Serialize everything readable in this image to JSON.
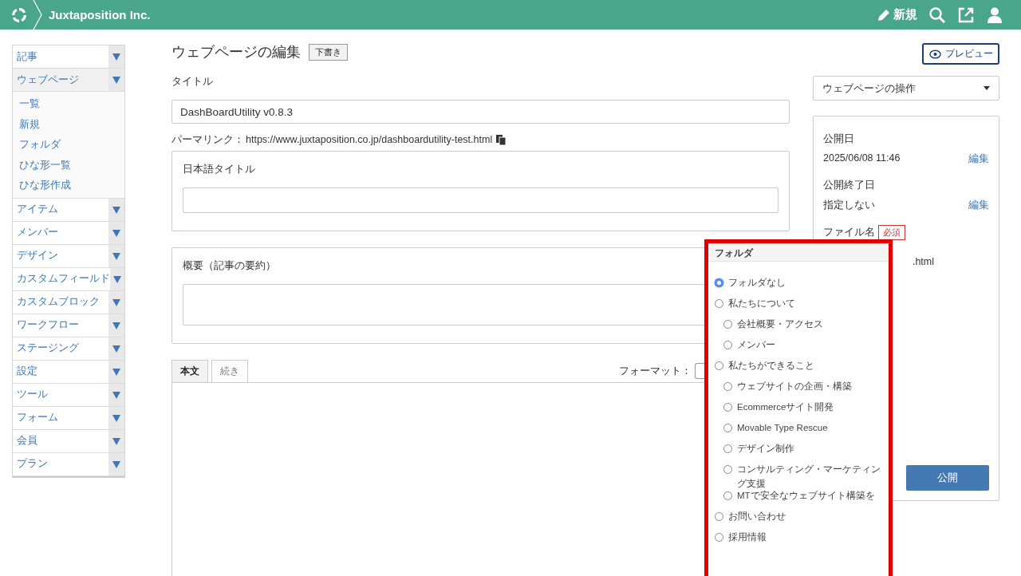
{
  "header": {
    "company": "Juxtaposition Inc.",
    "new_label": "新規"
  },
  "sidebar": {
    "items": [
      {
        "label": "記事",
        "expanded": false
      },
      {
        "label": "ウェブページ",
        "expanded": true,
        "children": [
          {
            "label": "一覧"
          },
          {
            "label": "新規"
          },
          {
            "label": "フォルダ"
          },
          {
            "label": "ひな形一覧"
          },
          {
            "label": "ひな形作成"
          }
        ]
      },
      {
        "label": "アイテム",
        "expanded": false
      },
      {
        "label": "メンバー",
        "expanded": false
      },
      {
        "label": "デザイン",
        "expanded": false
      },
      {
        "label": "カスタムフィールド",
        "expanded": false
      },
      {
        "label": "カスタムブロック",
        "expanded": false
      },
      {
        "label": "ワークフロー",
        "expanded": false
      },
      {
        "label": "ステージング",
        "expanded": false
      },
      {
        "label": "設定",
        "expanded": false
      },
      {
        "label": "ツール",
        "expanded": false
      },
      {
        "label": "フォーム",
        "expanded": false
      },
      {
        "label": "会員",
        "expanded": false
      },
      {
        "label": "プラン",
        "expanded": false
      }
    ]
  },
  "page": {
    "heading": "ウェブページの編集",
    "status_badge": "下書き",
    "title_label": "タイトル",
    "title_value": "DashBoardUtility v0.8.3",
    "permalink_label": "パーマリンク：",
    "permalink_url": "https://www.juxtaposition.co.jp/dashboardutility-test.html",
    "japanese_title_label": "日本語タイトル",
    "summary_label": "概要（記事の要約）",
    "tabs": [
      {
        "label": "本文",
        "selected": true
      },
      {
        "label": "続き",
        "selected": false
      }
    ],
    "format_label": "フォーマット："
  },
  "right": {
    "preview_button": "プレビュー",
    "actions_dropdown": "ウェブページの操作",
    "publish_date_label": "公開日",
    "publish_date": "2025/06/08 11:46",
    "publish_date_edit": "編集",
    "end_date_label": "公開終了日",
    "end_date": "指定しない",
    "end_date_edit": "編集",
    "filename_label": "ファイル名",
    "required_badge": "必須",
    "filename_suffix": ".html",
    "publish_button": "公開"
  },
  "folder_popup": {
    "title": "フォルダ",
    "items": [
      {
        "label": "フォルダなし",
        "selected": true
      },
      {
        "label": "私たちについて",
        "selected": false,
        "children": [
          {
            "label": "会社概要・アクセス",
            "selected": false
          },
          {
            "label": "メンバー",
            "selected": false
          }
        ]
      },
      {
        "label": "私たちができること",
        "selected": false,
        "children": [
          {
            "label": "ウェブサイトの企画・構築",
            "selected": false
          },
          {
            "label": "Ecommerceサイト開発",
            "selected": false
          },
          {
            "label": "Movable Type Rescue",
            "selected": false
          },
          {
            "label": "デザイン制作",
            "selected": false
          },
          {
            "label": "コンサルティング・マーケティング支援",
            "selected": false
          },
          {
            "label": "MTで安全なウェブサイト構築を",
            "selected": false
          }
        ]
      },
      {
        "label": "お問い合わせ",
        "selected": false
      },
      {
        "label": "採用情報",
        "selected": false
      }
    ]
  }
}
